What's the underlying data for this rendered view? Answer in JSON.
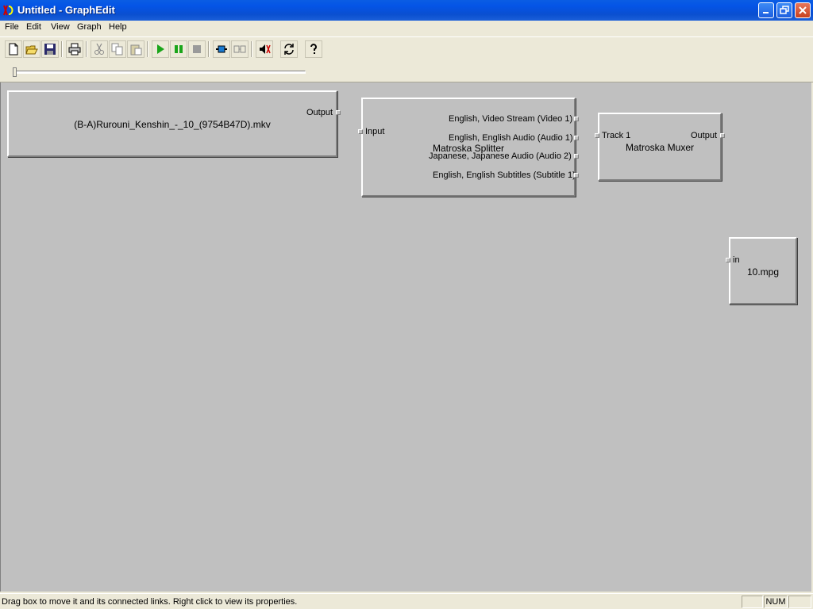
{
  "window": {
    "title": "Untitled - GraphEdit"
  },
  "menu": [
    "File",
    "Edit",
    "View",
    "Graph",
    "Help"
  ],
  "toolbar": {
    "buttons": [
      {
        "icon": "new-file-icon",
        "enabled": true
      },
      {
        "icon": "open-folder-icon",
        "enabled": true
      },
      {
        "icon": "save-disk-icon",
        "enabled": true
      },
      {
        "icon": "print-icon",
        "enabled": true
      },
      {
        "icon": "cut-icon",
        "enabled": false
      },
      {
        "icon": "copy-icon",
        "enabled": false
      },
      {
        "icon": "paste-icon",
        "enabled": false
      },
      {
        "icon": "play-icon",
        "enabled": true
      },
      {
        "icon": "pause-icon",
        "enabled": true
      },
      {
        "icon": "stop-icon",
        "enabled": false
      },
      {
        "icon": "seek-icon",
        "enabled": true
      },
      {
        "icon": "frame-step-icon",
        "enabled": false
      },
      {
        "icon": "sync-icon",
        "enabled": true
      },
      {
        "icon": "refresh-icon",
        "enabled": true
      },
      {
        "icon": "help-icon",
        "enabled": true
      }
    ],
    "colors": {
      "play": "#1aa51a",
      "pause": "#1aa51a",
      "seek": "#1a7ad0"
    }
  },
  "seek": {
    "position": 0
  },
  "filters": {
    "source": {
      "name": "(B-A)Rurouni_Kenshin_-_10_(9754B47D).mkv",
      "pins_out": [
        "Output"
      ]
    },
    "splitter": {
      "name": "Matroska Splitter",
      "pins_in": [
        "Input"
      ],
      "pins_out": [
        "English, Video Stream (Video 1)",
        "English, English Audio (Audio 1)",
        "Japanese, Japanese Audio (Audio 2)",
        "English, English Subtitles (Subtitle 1)"
      ]
    },
    "muxer": {
      "name": "Matroska Muxer",
      "pins_in": [
        "Track 1"
      ],
      "pins_out": [
        "Output"
      ]
    },
    "writer": {
      "name": "10.mpg",
      "pins_in": [
        "in"
      ]
    }
  },
  "canvas": {
    "background": "#c0c0c0"
  },
  "statusbar": {
    "text": "Drag box to move it and its connected links. Right click to view its properties.",
    "panels": [
      "",
      "NUM",
      ""
    ]
  }
}
